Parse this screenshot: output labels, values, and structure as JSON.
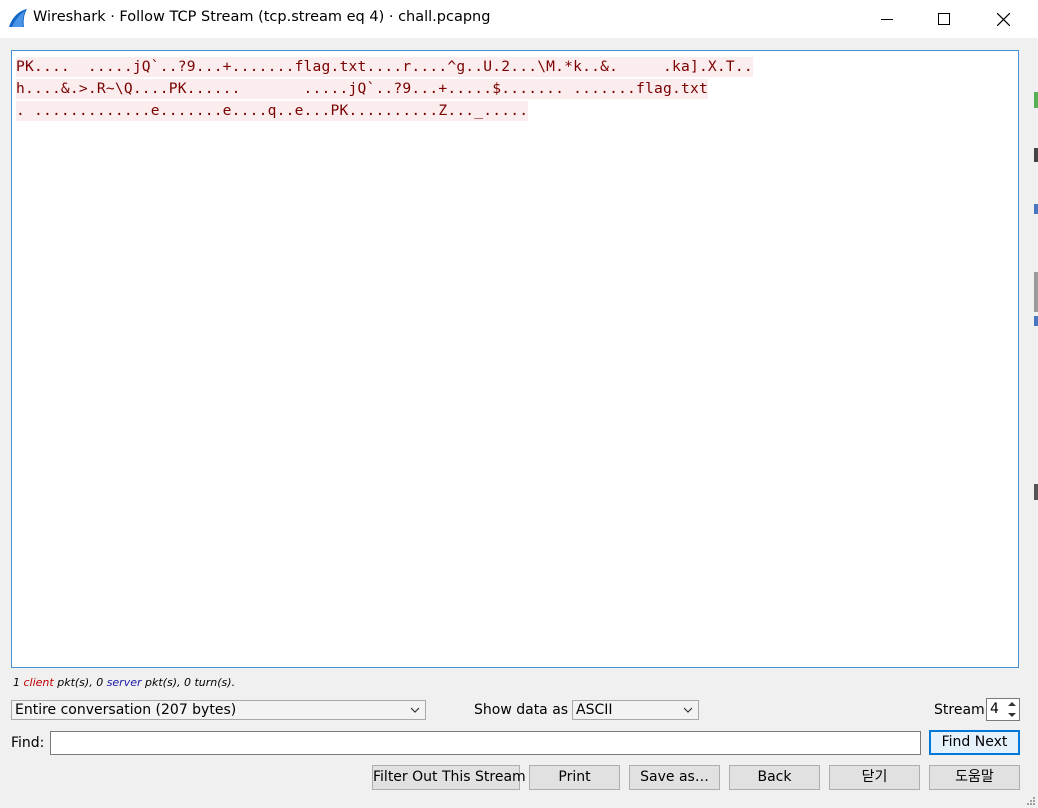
{
  "window": {
    "title": "Wireshark · Follow TCP Stream (tcp.stream eq 4) · chall.pcapng"
  },
  "stream": {
    "lines": [
      "PK....  .....jQ`..?9...+.......flag.txt....r....^g..U.2...\\M.*k..&.     .ka].X.T..",
      "h....&.>.R~\\Q....PK......       .....jQ`..?9...+.....$....... .......flag.txt",
      ". .............e.......e....q..e...PK..........Z..._....."
    ],
    "client_color": "#7b0000",
    "highlight_color": "#fbeded"
  },
  "summary": {
    "client_count": "1",
    "client_word": "client",
    "client_suffix": " pkt(s), 0 ",
    "server_word": "server",
    "server_suffix": " pkt(s), 0 turn(s)."
  },
  "controls": {
    "conversation_select": "Entire conversation (207 bytes)",
    "show_data_label": "Show data as",
    "show_data_value": "ASCII",
    "stream_label": "Stream",
    "stream_value": "4",
    "find_label": "Find:",
    "find_value": "",
    "find_next": "Find Next"
  },
  "buttons": {
    "filter_out": "Filter Out This Stream",
    "print": "Print",
    "save_as": "Save as…",
    "back": "Back",
    "close": "닫기",
    "help": "도움말"
  }
}
